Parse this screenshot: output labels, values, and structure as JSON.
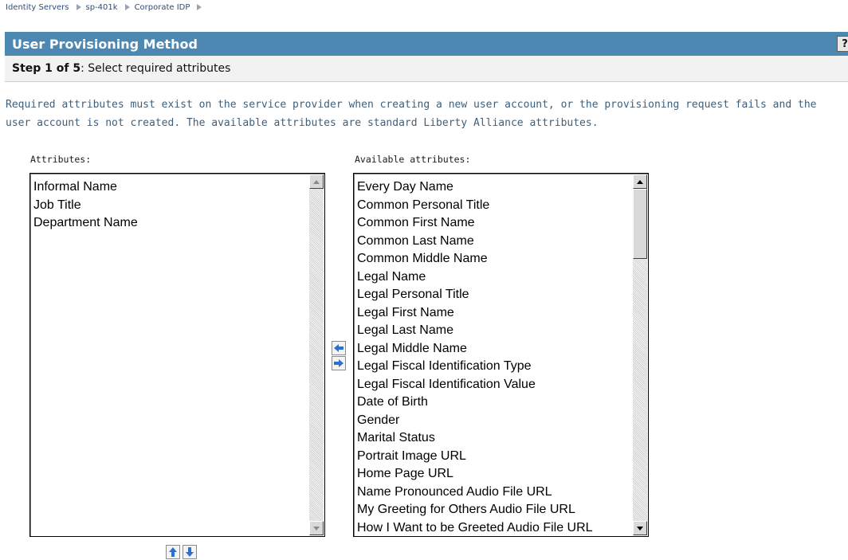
{
  "breadcrumb": [
    "Identity Servers",
    "sp-401k",
    "Corporate IDP"
  ],
  "header": {
    "title": "User Provisioning Method",
    "help_label": "?"
  },
  "step": {
    "label": "Step 1 of 5",
    "text": ": Select required attributes"
  },
  "description": "Required attributes must exist on the service provider when creating a new user account, or the provisioning request fails and the user account is not created. The available attributes are standard Liberty Alliance attributes.",
  "attributes": {
    "label": "Attributes:",
    "items": [
      "Informal Name",
      "Job Title",
      "Department Name"
    ]
  },
  "available": {
    "label": "Available attributes:",
    "items": [
      "Every Day Name",
      "Common Personal Title",
      "Common First Name",
      "Common Last Name",
      "Common Middle Name",
      "Legal Name",
      "Legal Personal Title",
      "Legal First Name",
      "Legal Last Name",
      "Legal Middle Name",
      "Legal Fiscal Identification Type",
      "Legal Fiscal Identification Value",
      "Date of Birth",
      "Gender",
      "Marital Status",
      "Portrait Image URL",
      "Home Page URL",
      "Name Pronounced Audio File URL",
      "My Greeting for Others Audio File URL",
      "How I Want to be Greeted Audio File URL"
    ]
  },
  "icons": {
    "move_left": "arrow-left-icon",
    "move_right": "arrow-right-icon",
    "move_up": "arrow-up-icon",
    "move_down": "arrow-down-icon"
  },
  "colors": {
    "header_bg": "#4d88b3",
    "link": "#2b4e7a",
    "arrow_blue": "#2f6fd0"
  }
}
